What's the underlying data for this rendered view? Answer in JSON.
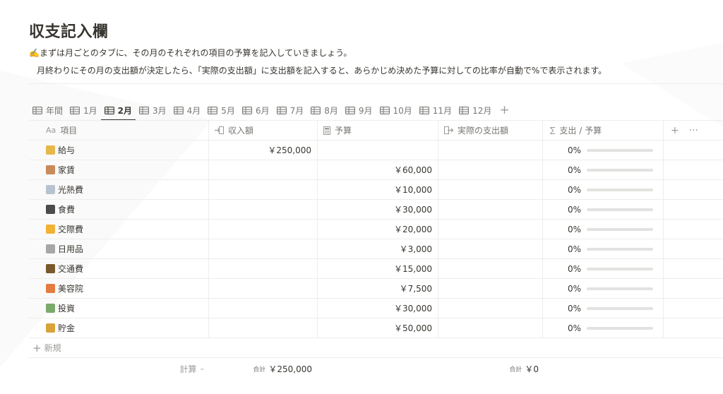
{
  "page": {
    "title": "収支記入欄",
    "description_line1": "✍️まずは月ごとのタブに、その月のそれぞれの項目の予算を記入していきましょう。",
    "description_line2": "月終わりにその月の支出額が決定したら、「実際の支出額」に支出額を記入すると、あらかじめ決めた予算に対しての比率が自動で%で表示されます。"
  },
  "tabs": [
    {
      "label": "年間",
      "icon": "table-icon",
      "active": false
    },
    {
      "label": "1月",
      "icon": "table-icon",
      "active": false
    },
    {
      "label": "2月",
      "icon": "table-icon",
      "active": true
    },
    {
      "label": "3月",
      "icon": "table-icon",
      "active": false
    },
    {
      "label": "4月",
      "icon": "table-icon",
      "active": false
    },
    {
      "label": "5月",
      "icon": "table-icon",
      "active": false
    },
    {
      "label": "6月",
      "icon": "table-icon",
      "active": false
    },
    {
      "label": "7月",
      "icon": "table-icon",
      "active": false
    },
    {
      "label": "8月",
      "icon": "table-icon",
      "active": false
    },
    {
      "label": "9月",
      "icon": "table-icon",
      "active": false
    },
    {
      "label": "10月",
      "icon": "table-icon",
      "active": false
    },
    {
      "label": "11月",
      "icon": "table-icon",
      "active": false
    },
    {
      "label": "12月",
      "icon": "table-icon",
      "active": false
    }
  ],
  "tab_add_label": "+",
  "columns": {
    "name": {
      "label": "項目",
      "icon_text": "Aa"
    },
    "income": {
      "label": "収入額",
      "icon": "income-arrow-icon"
    },
    "budget": {
      "label": "予算",
      "icon": "calculator-icon"
    },
    "actual": {
      "label": "実際の支出額",
      "icon": "outgoing-arrow-icon"
    },
    "ratio": {
      "label": "支出 / 予算",
      "icon_text": "∑"
    },
    "add_column": "+",
    "more": "···"
  },
  "rows": [
    {
      "name": "給与",
      "emoji_color": "#e6b84a",
      "income": "￥250,000",
      "budget": "",
      "actual": "",
      "ratio": "0%",
      "ratio_value": 0
    },
    {
      "name": "家賃",
      "emoji_color": "#c98b5a",
      "income": "",
      "budget": "￥60,000",
      "actual": "",
      "ratio": "0%",
      "ratio_value": 0
    },
    {
      "name": "光熱費",
      "emoji_color": "#b7c4cf",
      "income": "",
      "budget": "￥10,000",
      "actual": "",
      "ratio": "0%",
      "ratio_value": 0
    },
    {
      "name": "食費",
      "emoji_color": "#4b4b4b",
      "income": "",
      "budget": "￥30,000",
      "actual": "",
      "ratio": "0%",
      "ratio_value": 0
    },
    {
      "name": "交際費",
      "emoji_color": "#f2b233",
      "income": "",
      "budget": "￥20,000",
      "actual": "",
      "ratio": "0%",
      "ratio_value": 0
    },
    {
      "name": "日用品",
      "emoji_color": "#a7a7a7",
      "income": "",
      "budget": "￥3,000",
      "actual": "",
      "ratio": "0%",
      "ratio_value": 0
    },
    {
      "name": "交通費",
      "emoji_color": "#7a5a2c",
      "income": "",
      "budget": "￥15,000",
      "actual": "",
      "ratio": "0%",
      "ratio_value": 0
    },
    {
      "name": "美容院",
      "emoji_color": "#e57c3f",
      "income": "",
      "budget": "￥7,500",
      "actual": "",
      "ratio": "0%",
      "ratio_value": 0
    },
    {
      "name": "投資",
      "emoji_color": "#7bab6a",
      "income": "",
      "budget": "￥30,000",
      "actual": "",
      "ratio": "0%",
      "ratio_value": 0
    },
    {
      "name": "貯金",
      "emoji_color": "#d9a33a",
      "income": "",
      "budget": "￥50,000",
      "actual": "",
      "ratio": "0%",
      "ratio_value": 0
    }
  ],
  "new_row_label": "新規",
  "footer": {
    "calc_label": "計算",
    "income_total_label": "合計",
    "income_total": "￥250,000",
    "actual_total_label": "合計",
    "actual_total": "￥0"
  },
  "colors": {
    "text": "#37352f",
    "muted": "#787774",
    "border": "#ededeb",
    "bar_track": "#e3e2e0",
    "bar_fill": "#2eaadc"
  }
}
